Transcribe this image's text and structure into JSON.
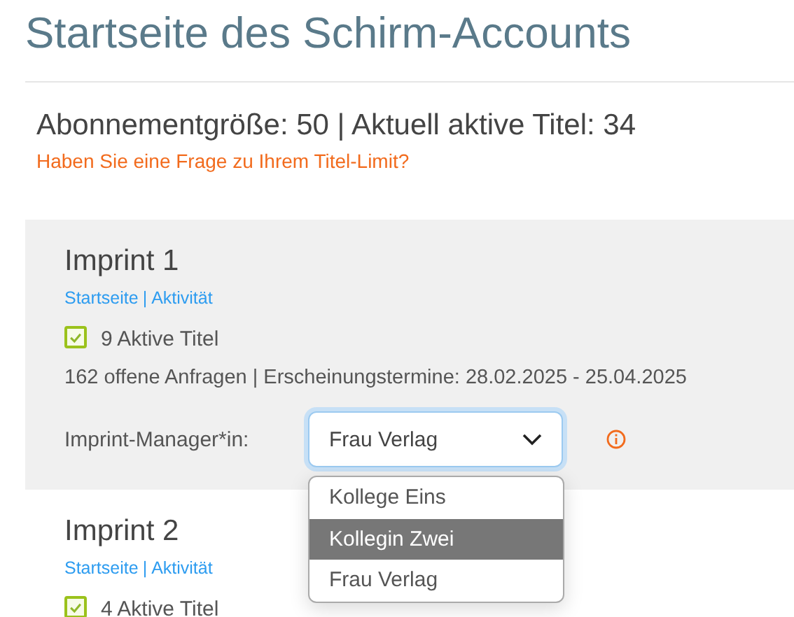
{
  "page_title": "Startseite des Schirm-Accounts",
  "summary": "Abonnementgröße: 50 | Aktuell aktive Titel: 34",
  "question_link": "Haben Sie eine Frage zu Ihrem Titel-Limit?",
  "imprints": [
    {
      "name": "Imprint 1",
      "links": [
        "Startseite",
        "Aktivität"
      ],
      "link_separator": "|",
      "active": {
        "checked": true,
        "text": "9 Aktive Titel"
      },
      "details": "162 offene Anfragen | Erscheinungstermine: 28.02.2025 - 25.04.2025",
      "manager": {
        "label": "Imprint-Manager*in:",
        "value": "Frau Verlag",
        "focused": true,
        "open": true,
        "options": [
          {
            "label": "Kollege Eins",
            "hovered": false
          },
          {
            "label": "Kollegin Zwei",
            "hovered": true
          },
          {
            "label": "Frau Verlag",
            "hovered": false
          }
        ]
      }
    },
    {
      "name": "Imprint 2",
      "links": [
        "Startseite",
        "Aktivität"
      ],
      "link_separator": "|",
      "active": {
        "checked": true,
        "text": "4 Aktive Titel"
      }
    }
  ]
}
